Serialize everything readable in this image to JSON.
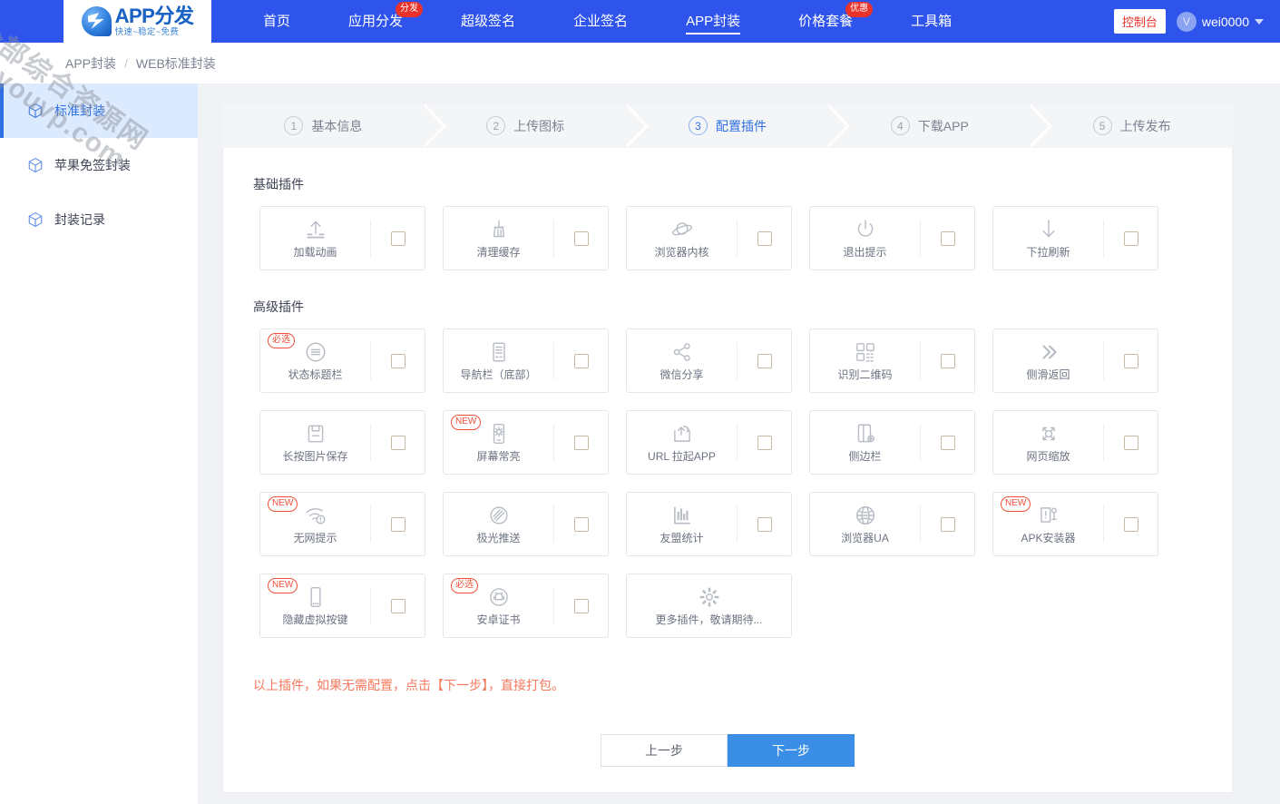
{
  "brand": {
    "logo_main": "APP分发",
    "logo_sub": "快速~稳定~免费"
  },
  "watermark": {
    "line1": "全部综合资源网",
    "line2": "douyouvp.com"
  },
  "topnav": {
    "items": [
      {
        "label": "首页",
        "badge": "",
        "active": false
      },
      {
        "label": "应用分发",
        "badge": "分发",
        "active": false
      },
      {
        "label": "超级签名",
        "badge": "",
        "active": false
      },
      {
        "label": "企业签名",
        "badge": "",
        "active": false
      },
      {
        "label": "APP封装",
        "badge": "",
        "active": true
      },
      {
        "label": "价格套餐",
        "badge": "优惠",
        "active": false
      },
      {
        "label": "工具箱",
        "badge": "",
        "active": false
      }
    ],
    "console_label": "控制台",
    "user_name": "wei0000",
    "avatar_letter": "V"
  },
  "breadcrumb": {
    "parent": "APP封装",
    "separator": "/",
    "current": "WEB标准封装"
  },
  "sidebar": {
    "items": [
      {
        "label": "标准封装",
        "icon": "cube-icon",
        "active": true
      },
      {
        "label": "苹果免签封装",
        "icon": "cube-icon",
        "active": false
      },
      {
        "label": "封装记录",
        "icon": "cube-icon",
        "active": false
      }
    ]
  },
  "steps": [
    {
      "num": "1",
      "label": "基本信息",
      "current": false
    },
    {
      "num": "2",
      "label": "上传图标",
      "current": false
    },
    {
      "num": "3",
      "label": "配置插件",
      "current": true
    },
    {
      "num": "4",
      "label": "下载APP",
      "current": false
    },
    {
      "num": "5",
      "label": "上传发布",
      "current": false
    }
  ],
  "basic_section": {
    "title": "基础插件",
    "plugins": [
      {
        "label": "加载动画",
        "icon": "upload-arrow-icon",
        "tag": "",
        "checked": false,
        "has_checkbox": true
      },
      {
        "label": "清理缓存",
        "icon": "broom-icon",
        "tag": "",
        "checked": false,
        "has_checkbox": true
      },
      {
        "label": "浏览器内核",
        "icon": "planet-icon",
        "tag": "",
        "checked": false,
        "has_checkbox": true
      },
      {
        "label": "退出提示",
        "icon": "power-icon",
        "tag": "",
        "checked": false,
        "has_checkbox": true
      },
      {
        "label": "下拉刷新",
        "icon": "download-arrow-icon",
        "tag": "",
        "checked": false,
        "has_checkbox": true
      }
    ]
  },
  "advanced_section": {
    "title": "高级插件",
    "plugins": [
      {
        "label": "状态标题栏",
        "icon": "menu-circle-icon",
        "tag": "必选",
        "checked": false,
        "has_checkbox": true
      },
      {
        "label": "导航栏（底部）",
        "icon": "list-doc-icon",
        "tag": "",
        "checked": false,
        "has_checkbox": true
      },
      {
        "label": "微信分享",
        "icon": "share-icon",
        "tag": "",
        "checked": false,
        "has_checkbox": true
      },
      {
        "label": "识别二维码",
        "icon": "qrcode-icon",
        "tag": "",
        "checked": false,
        "has_checkbox": true
      },
      {
        "label": "侧滑返回",
        "icon": "double-chevron-right-icon",
        "tag": "",
        "checked": false,
        "has_checkbox": true
      },
      {
        "label": "长按图片保存",
        "icon": "save-disk-icon",
        "tag": "",
        "checked": false,
        "has_checkbox": true
      },
      {
        "label": "屏幕常亮",
        "icon": "phone-brightness-icon",
        "tag": "NEW",
        "checked": false,
        "has_checkbox": true
      },
      {
        "label": "URL 拉起APP",
        "icon": "external-link-icon",
        "tag": "",
        "checked": false,
        "has_checkbox": true
      },
      {
        "label": "侧边栏",
        "icon": "sidebar-phone-icon",
        "tag": "",
        "checked": false,
        "has_checkbox": true
      },
      {
        "label": "网页缩放",
        "icon": "zoom-expand-icon",
        "tag": "",
        "checked": false,
        "has_checkbox": true
      },
      {
        "label": "无网提示",
        "icon": "wifi-alert-icon",
        "tag": "NEW",
        "checked": false,
        "has_checkbox": true
      },
      {
        "label": "极光推送",
        "icon": "aurora-push-icon",
        "tag": "",
        "checked": false,
        "has_checkbox": true
      },
      {
        "label": "友盟统计",
        "icon": "bar-chart-icon",
        "tag": "",
        "checked": false,
        "has_checkbox": true
      },
      {
        "label": "浏览器UA",
        "icon": "globe-icon",
        "tag": "",
        "checked": false,
        "has_checkbox": true
      },
      {
        "label": "APK安装器",
        "icon": "apk-install-icon",
        "tag": "NEW",
        "checked": false,
        "has_checkbox": true
      },
      {
        "label": "隐藏虚拟按键",
        "icon": "phone-icon",
        "tag": "NEW",
        "checked": false,
        "has_checkbox": true
      },
      {
        "label": "安卓证书",
        "icon": "android-circle-icon",
        "tag": "必选",
        "checked": false,
        "has_checkbox": true
      },
      {
        "label": "更多插件，敬请期待...",
        "icon": "gear-icon",
        "tag": "",
        "checked": false,
        "has_checkbox": false
      }
    ]
  },
  "footer": {
    "hint": "以上插件，如果无需配置，点击【下一步】，直接打包。",
    "prev_label": "上一步",
    "next_label": "下一步"
  },
  "colors": {
    "nav_blue": "#2f54eb",
    "accent_blue": "#3a8ee6",
    "badge_red": "#e8322a",
    "tag_orange": "#f0503a",
    "hint_orange": "#f4795c"
  }
}
